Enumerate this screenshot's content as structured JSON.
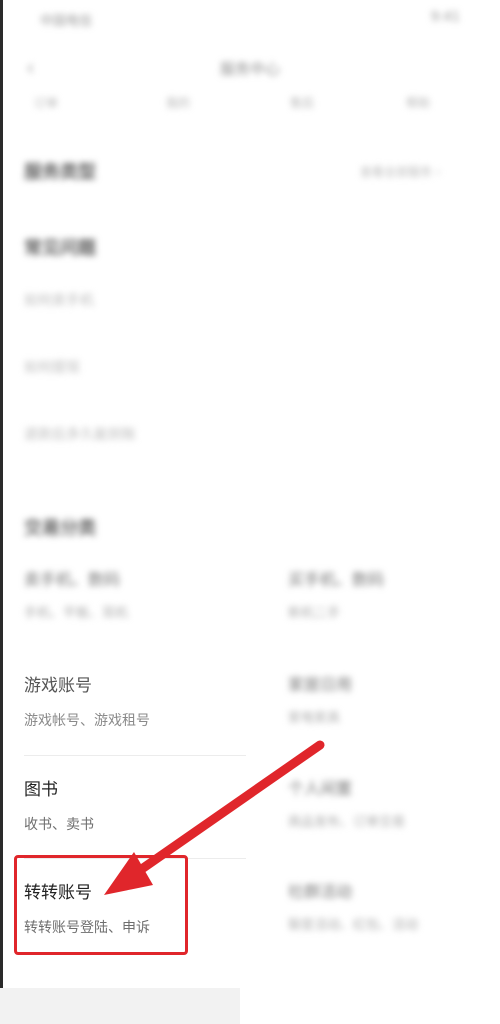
{
  "status_bar": {
    "carrier": "中国电信",
    "time": "9:41"
  },
  "header": {
    "back_icon": "‹",
    "title": "服务中心"
  },
  "tabs": [
    "订单",
    "我的",
    "售后",
    "帮助"
  ],
  "section_top": {
    "title": "服务类型",
    "right_link": "查看全部服务 ›"
  },
  "section_common": {
    "title": "常见问题",
    "items": [
      "如何卖手机",
      "如何提现",
      "退款后多久能到账"
    ]
  },
  "section_categories": {
    "title": "交易分类",
    "left_column": [
      {
        "title": "卖手机、数码",
        "sub": "手机、平板、耳机"
      },
      {
        "title": "游戏账号",
        "sub": "游戏帐号、游戏租号"
      },
      {
        "title": "图书",
        "sub": "收书、卖书"
      },
      {
        "title": "转转账号",
        "sub": "转转账号登陆、申诉"
      }
    ],
    "right_column": [
      {
        "title": "买手机、数码",
        "sub": "新机二手"
      },
      {
        "title": "家居日用",
        "sub": "家电家具"
      },
      {
        "title": "个人闲置",
        "sub": "商品发布、订单交易"
      },
      {
        "title": "社群活动",
        "sub": "裂变活动、红包、活动"
      }
    ]
  },
  "annotation": {
    "arrow_color": "#e0262b"
  }
}
